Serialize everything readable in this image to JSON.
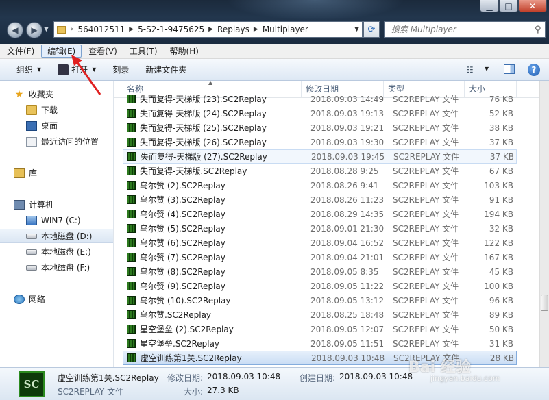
{
  "address": {
    "crumbs": [
      "564012511",
      "5-S2-1-9475625",
      "Replays",
      "Multiplayer"
    ],
    "search_placeholder": "搜索 Multiplayer"
  },
  "menu": [
    "文件(F)",
    "编辑(E)",
    "查看(V)",
    "工具(T)",
    "帮助(H)"
  ],
  "toolbar": {
    "organize": "组织",
    "open": "打开",
    "burn": "刻录",
    "new_folder": "新建文件夹"
  },
  "nav": {
    "favorites": "收藏夹",
    "downloads": "下载",
    "desktop": "桌面",
    "recent": "最近访问的位置",
    "libraries": "库",
    "computer": "计算机",
    "drives": [
      "WIN7 (C:)",
      "本地磁盘 (D:)",
      "本地磁盘 (E:)",
      "本地磁盘 (F:)"
    ],
    "network": "网络"
  },
  "columns": {
    "name": "名称",
    "date": "修改日期",
    "type": "类型",
    "size": "大小"
  },
  "files": [
    {
      "name": "失而复得-天梯版 (23).SC2Replay",
      "date": "2018.09.03 14:49",
      "type": "SC2REPLAY 文件",
      "size": "76 KB"
    },
    {
      "name": "失而复得-天梯版 (24).SC2Replay",
      "date": "2018.09.03 19:13",
      "type": "SC2REPLAY 文件",
      "size": "52 KB"
    },
    {
      "name": "失而复得-天梯版 (25).SC2Replay",
      "date": "2018.09.03 19:21",
      "type": "SC2REPLAY 文件",
      "size": "38 KB"
    },
    {
      "name": "失而复得-天梯版 (26).SC2Replay",
      "date": "2018.09.03 19:30",
      "type": "SC2REPLAY 文件",
      "size": "37 KB"
    },
    {
      "name": "失而复得-天梯版 (27).SC2Replay",
      "date": "2018.09.03 19:45",
      "type": "SC2REPLAY 文件",
      "size": "37 KB"
    },
    {
      "name": "失而复得-天梯版.SC2Replay",
      "date": "2018.08.28 9:25",
      "type": "SC2REPLAY 文件",
      "size": "67 KB"
    },
    {
      "name": "乌尔赞 (2).SC2Replay",
      "date": "2018.08.26 9:41",
      "type": "SC2REPLAY 文件",
      "size": "103 KB"
    },
    {
      "name": "乌尔赞 (3).SC2Replay",
      "date": "2018.08.26 11:23",
      "type": "SC2REPLAY 文件",
      "size": "91 KB"
    },
    {
      "name": "乌尔赞 (4).SC2Replay",
      "date": "2018.08.29 14:35",
      "type": "SC2REPLAY 文件",
      "size": "194 KB"
    },
    {
      "name": "乌尔赞 (5).SC2Replay",
      "date": "2018.09.01 21:30",
      "type": "SC2REPLAY 文件",
      "size": "32 KB"
    },
    {
      "name": "乌尔赞 (6).SC2Replay",
      "date": "2018.09.04 16:52",
      "type": "SC2REPLAY 文件",
      "size": "122 KB"
    },
    {
      "name": "乌尔赞 (7).SC2Replay",
      "date": "2018.09.04 21:01",
      "type": "SC2REPLAY 文件",
      "size": "167 KB"
    },
    {
      "name": "乌尔赞 (8).SC2Replay",
      "date": "2018.09.05 8:35",
      "type": "SC2REPLAY 文件",
      "size": "45 KB"
    },
    {
      "name": "乌尔赞 (9).SC2Replay",
      "date": "2018.09.05 11:22",
      "type": "SC2REPLAY 文件",
      "size": "100 KB"
    },
    {
      "name": "乌尔赞 (10).SC2Replay",
      "date": "2018.09.05 13:12",
      "type": "SC2REPLAY 文件",
      "size": "96 KB"
    },
    {
      "name": "乌尔赞.SC2Replay",
      "date": "2018.08.25 18:48",
      "type": "SC2REPLAY 文件",
      "size": "89 KB"
    },
    {
      "name": "星空堡垒 (2).SC2Replay",
      "date": "2018.09.05 12:07",
      "type": "SC2REPLAY 文件",
      "size": "50 KB"
    },
    {
      "name": "星空堡垒.SC2Replay",
      "date": "2018.09.05 11:51",
      "type": "SC2REPLAY 文件",
      "size": "31 KB"
    },
    {
      "name": "虚空训练第1关.SC2Replay",
      "date": "2018.09.03 10:48",
      "type": "SC2REPLAY 文件",
      "size": "28 KB"
    }
  ],
  "details": {
    "name": "虚空训练第1关.SC2Replay",
    "modified_label": "修改日期:",
    "modified": "2018.09.03 10:48",
    "created_label": "创建日期:",
    "created": "2018.09.03 10:48",
    "type": "SC2REPLAY 文件",
    "size_label": "大小:",
    "size": "27.3 KB",
    "icon_letters": "SC"
  },
  "watermark": {
    "text": "Bai 经验",
    "sub": "jingyan.baidu.com"
  }
}
